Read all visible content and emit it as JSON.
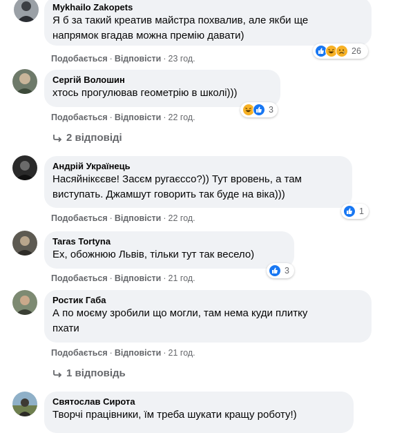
{
  "comments": [
    {
      "author": "Mykhailo Zakopets",
      "text": "Я б за такий креатив майстра похвалив, але якби ще\nнапрямок вгадав можна премію давати)",
      "like_label": "Подобається",
      "reply_label": "Відповісти",
      "time": "23 год.",
      "reactions": [
        "like-icon",
        "haha-icon",
        "sad-icon"
      ],
      "reaction_count": "26"
    },
    {
      "author": "Сергій Волошин",
      "text": "хтось прогулював геометрію в школі)))",
      "like_label": "Подобається",
      "reply_label": "Відповісти",
      "time": "22 год.",
      "reactions": [
        "haha-icon",
        "like-icon"
      ],
      "reaction_count": "3",
      "replies_label": "2 відповіді"
    },
    {
      "author": "Андрій Українець",
      "text": "Насяйнікєєве! Засєм ругаєссо?)) Тут вровень, а там\nвиступать. Джамшут говорить так буде на віка)))",
      "like_label": "Подобається",
      "reply_label": "Відповісти",
      "time": "22 год.",
      "reactions": [
        "like-icon"
      ],
      "reaction_count": "1"
    },
    {
      "author": "Taras Tortyna",
      "text": "Ех, обожнюю Львів, тільки тут так весело)",
      "like_label": "Подобається",
      "reply_label": "Відповісти",
      "time": "21 год.",
      "reactions": [
        "like-icon"
      ],
      "reaction_count": "3"
    },
    {
      "author": "Ростик Габа",
      "text": "А по моєму зробили що могли, там нема куди плитку\nпхати",
      "like_label": "Подобається",
      "reply_label": "Відповісти",
      "time": "21 год.",
      "replies_label": "1 відповідь"
    },
    {
      "author": "Святослав Сирота",
      "text": "Творчі працівники, їм треба шукати кращу роботу!)"
    }
  ],
  "separator": "·",
  "colors": {
    "bubble": "#f0f2f5",
    "meta_text": "#65676b",
    "like_blue": "#1877f2",
    "haha_yellow": "#f7b125"
  }
}
